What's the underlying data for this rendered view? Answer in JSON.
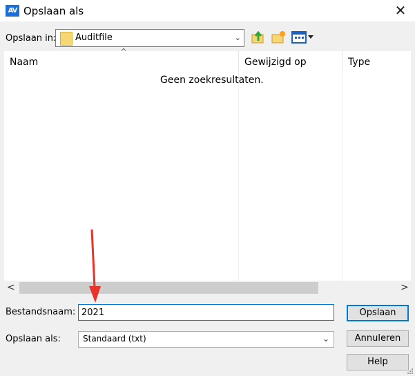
{
  "window": {
    "title": "Opslaan als",
    "app_icon_text": "AV",
    "close_glyph": "✕"
  },
  "toolbar": {
    "lookin_label": "Opslaan in:",
    "lookin_value": "Auditfile",
    "up_icon": "folder-up-icon",
    "newfolder_icon": "new-folder-icon",
    "view_icon": "view-menu-icon"
  },
  "list": {
    "columns": [
      "Naam",
      "Gewijzigd op",
      "Type"
    ],
    "sort_caret": "^",
    "empty_message": "Geen zoekresultaten."
  },
  "scrollbar": {
    "left_glyph": "<",
    "right_glyph": ">"
  },
  "filename": {
    "label": "Bestandsnaam:",
    "value": "2021"
  },
  "filetype": {
    "label": "Opslaan als:",
    "value": "Standaard (txt)"
  },
  "buttons": {
    "save": "Opslaan",
    "cancel": "Annuleren",
    "help": "Help"
  },
  "colors": {
    "accent": "#0078d7",
    "annotation_arrow": "#e8332b"
  }
}
